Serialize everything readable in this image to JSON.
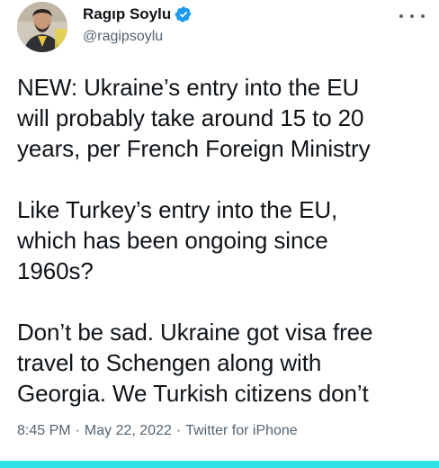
{
  "author": {
    "display_name": "Ragıp Soylu",
    "handle": "@ragipsoylu",
    "avatar_icon": "user-avatar-icon",
    "verified_icon": "verified-badge-icon",
    "verified_color": "#1d9bf0"
  },
  "more_icon": "more-options-icon",
  "tweet": {
    "paragraphs": [
      {
        "lines": [
          "NEW: Ukraine’s entry into the EU",
          "will probably take around 15 to 20",
          "years, per French Foreign Ministry"
        ]
      },
      {
        "lines": [
          "Like Turkey’s entry into the EU,",
          "which has been ongoing since",
          "1960s?"
        ]
      },
      {
        "lines": [
          "Don’t be sad. Ukraine got visa free",
          "travel to Schengen along with",
          "Georgia. We Turkish citizens don’t"
        ]
      }
    ]
  },
  "meta": {
    "time": "8:45 PM",
    "separator": "·",
    "date": "May 22, 2022",
    "source": "Twitter for iPhone"
  },
  "colors": {
    "text_primary": "#0f1419",
    "text_secondary": "#536471",
    "accent_bar": "#2de1e6"
  }
}
